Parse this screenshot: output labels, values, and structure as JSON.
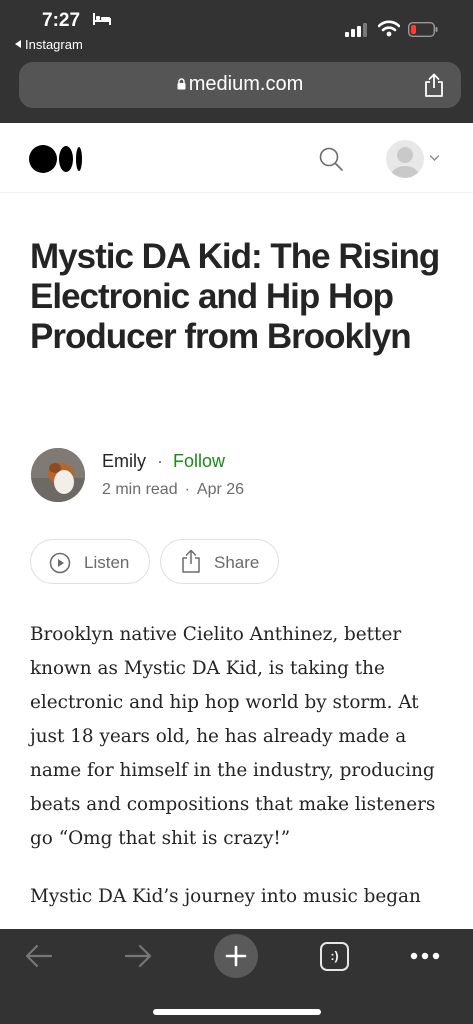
{
  "status_bar": {
    "time": "7:27",
    "back_app": "Instagram"
  },
  "browser": {
    "url": "medium.com"
  },
  "article": {
    "title": "Mystic DA Kid: The Rising Electronic and Hip Hop Producer from Brooklyn",
    "author": "Emily",
    "separator": "·",
    "follow_label": "Follow",
    "read_time": "2 min read",
    "date": "Apr 26",
    "listen_label": "Listen",
    "share_label": "Share",
    "paragraphs": [
      "Brooklyn native Cielito Anthinez, better known as Mystic DA Kid, is taking the electronic and hip hop world by storm. At just 18 years old, he has already made a name for himself in the industry, producing beats and compositions that make listeners go “Omg that shit is crazy!”",
      "Mystic DA Kid’s journey into music began"
    ]
  },
  "bottom_bar": {
    "tabs_label": ":)"
  },
  "colors": {
    "chrome": "#333333",
    "url_bar": "#555556",
    "follow": "#1a8917",
    "text": "#242424",
    "muted": "#6b6b6b"
  },
  "icons": [
    "bed-icon",
    "signal-icon",
    "wifi-icon",
    "battery-icon",
    "lock-icon",
    "share-icon",
    "medium-logo",
    "search-icon",
    "user-avatar-icon",
    "chevron-down-icon",
    "play-icon",
    "arrow-left-icon",
    "arrow-right-icon",
    "plus-icon",
    "tabs-icon",
    "more-icon"
  ]
}
